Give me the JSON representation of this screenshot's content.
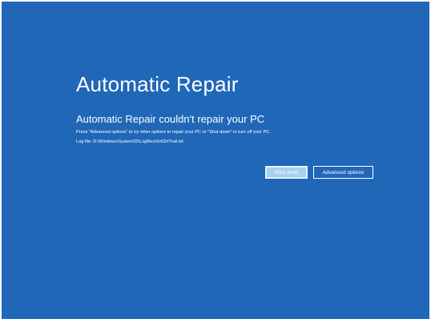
{
  "screen": {
    "background_color": "#2067b8",
    "title": "Automatic Repair",
    "subtitle": "Automatic Repair couldn't repair your PC",
    "detail_line": "Press \"Advanced options\" to try other options to repair your PC or \"Shut down\" to turn off your PC.",
    "log_line": "Log file: D:\\Windows\\System32\\Logfiles\\Srt\\SrtTrail.txt"
  },
  "buttons": {
    "shutdown_label": "Shut down",
    "advanced_label": "Advanced options",
    "shutdown_color": "#a6d1ef"
  }
}
